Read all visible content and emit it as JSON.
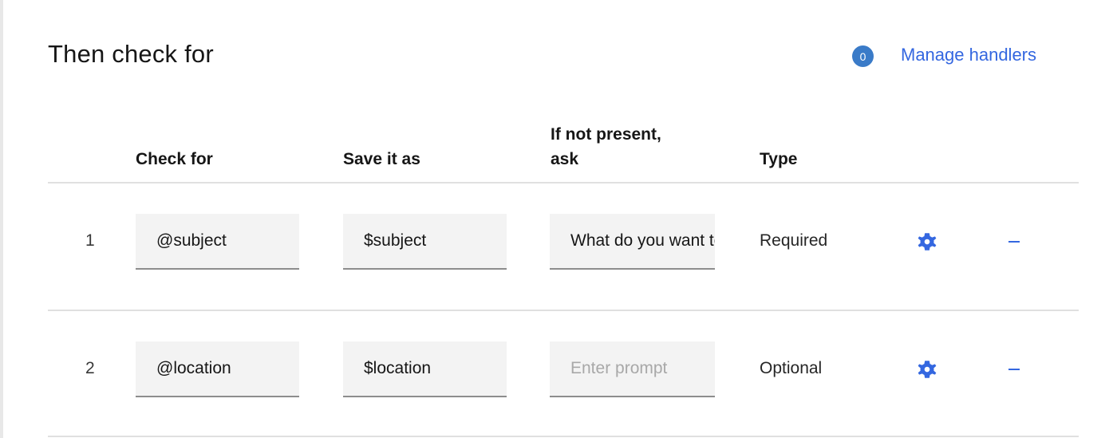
{
  "section": {
    "title": "Then check for",
    "handler_count": "0",
    "manage_handlers_label": "Manage handlers"
  },
  "table": {
    "headers": {
      "check_for": "Check for",
      "save_it_as": "Save it as",
      "if_not_present_line1": "If not present,",
      "if_not_present_line2": "ask",
      "type": "Type"
    },
    "rows": [
      {
        "number": "1",
        "check_for": "@subject",
        "save_as": "$subject",
        "prompt_value": "What do you want to know about?",
        "prompt_placeholder": "Enter prompt",
        "type": "Required",
        "settings_icon": "gear-icon",
        "remove_icon": "minus-icon"
      },
      {
        "number": "2",
        "check_for": "@location",
        "save_as": "$location",
        "prompt_value": "",
        "prompt_placeholder": "Enter prompt",
        "type": "Optional",
        "settings_icon": "gear-icon",
        "remove_icon": "minus-icon"
      }
    ]
  },
  "colors": {
    "accent": "#3467e0",
    "badge": "#3a7bc8",
    "field_bg": "#f3f3f3",
    "field_border": "#8d8d8d",
    "divider": "#e0e0e0"
  }
}
